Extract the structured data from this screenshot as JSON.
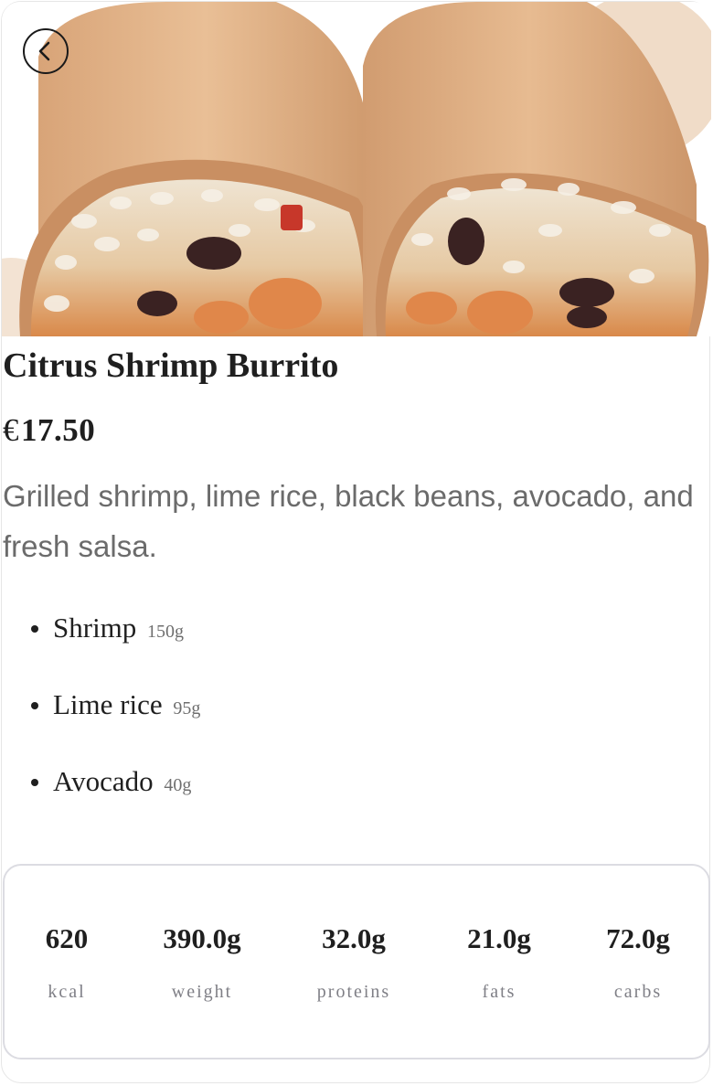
{
  "product": {
    "name": "Citrus Shrimp Burrito",
    "currency": "€",
    "price": "17.50",
    "description": "Grilled shrimp, lime rice, black beans, avocado, and fresh salsa."
  },
  "ingredients": [
    {
      "name": "Shrimp",
      "amount": "150g"
    },
    {
      "name": "Lime rice",
      "amount": "95g"
    },
    {
      "name": "Avocado",
      "amount": "40g"
    }
  ],
  "nutrition": [
    {
      "value": "620",
      "label": "kcal"
    },
    {
      "value": "390.0g",
      "label": "weight"
    },
    {
      "value": "32.0g",
      "label": "proteins"
    },
    {
      "value": "21.0g",
      "label": "fats"
    },
    {
      "value": "72.0g",
      "label": "carbs"
    }
  ],
  "icons": {
    "back": "chevron-left-icon"
  },
  "colors": {
    "tortilla": "#d9a67a",
    "accent_circle": "#f0dcc8",
    "text_primary": "#1f1f1f",
    "text_muted": "#6b6b6b"
  }
}
